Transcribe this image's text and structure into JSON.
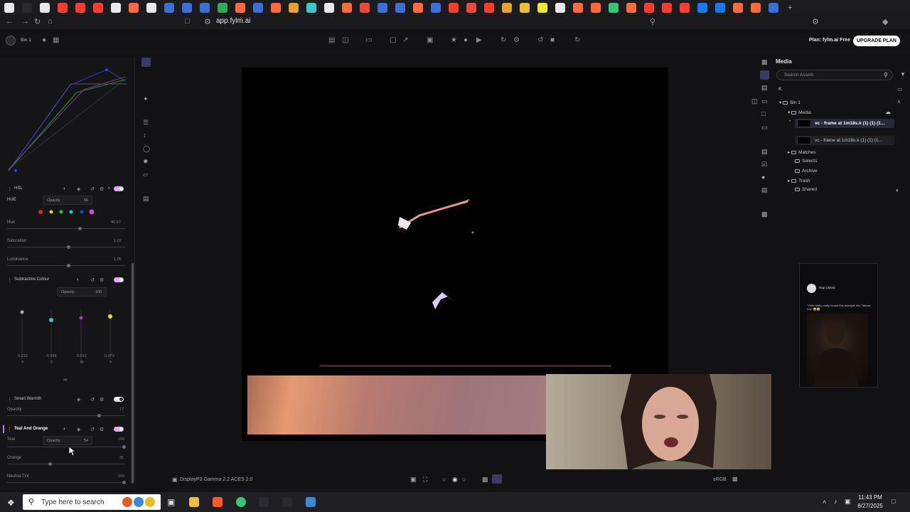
{
  "browser": {
    "url": "app.fylm.ai",
    "tab_favicon_colors": [
      "#e8e8e8",
      "#2b2b2b",
      "#e8e8e8",
      "#ff3b30",
      "#ff3b30",
      "#ff3b30",
      "#e8e8e8",
      "#ff6a3d",
      "#e8e8e8",
      "#3b6fd6",
      "#3b6fd6",
      "#3b6fd6",
      "#34a853",
      "#ff6a3d",
      "#3b6fd6",
      "#ff6a3d",
      "#e8a030",
      "#3ac7c7",
      "#e8e8e8",
      "#ff6a3d",
      "#e84a3d",
      "#3b6fd6",
      "#3b6fd6",
      "#ff6a3d",
      "#3b6fd6",
      "#ff3b30",
      "#e84a3d",
      "#ff3b30",
      "#e8a030",
      "#e8c030",
      "#e8e830",
      "#e8e8e8",
      "#ff6a3d",
      "#ff6a3d",
      "#34c873",
      "#ff6a3d",
      "#ff3b30",
      "#ff3b30",
      "#ff3b30",
      "#1877f2",
      "#1877f2",
      "#ff6a3d",
      "#ff6a3d",
      "#3b6fd6"
    ]
  },
  "app": {
    "workspace": "Bin 1",
    "plan": "Plan: fylm.ai Free",
    "upgrade_label": "UPGRADE PLAN"
  },
  "left_panel": {
    "hsl": {
      "title": "HSL",
      "mode": "HUE",
      "opacity_label": "Opacity",
      "opacity_value": "56",
      "swatches": [
        "#e8202a",
        "#e8d020",
        "#20d040",
        "#20c8c0",
        "#2040e8",
        "#e040e0"
      ],
      "sliders": [
        {
          "label": "Hue",
          "value": "40.67"
        },
        {
          "label": "Saturation",
          "value": "1.02"
        },
        {
          "label": "Luminance",
          "value": "1.05"
        }
      ]
    },
    "subtractive": {
      "title": "Subtractive Colour",
      "opacity_label": "Opacity",
      "opacity_value": "100",
      "values": [
        "0.216",
        "-0.048",
        "0.012",
        "0.072"
      ],
      "letters": [
        "Y",
        "C",
        "M",
        "Y"
      ]
    },
    "smart_warmth": {
      "title": "Smart Warmth",
      "sliders": [
        {
          "label": "Opacity",
          "value": "77"
        }
      ]
    },
    "teal_orange": {
      "title": "Teal And Orange",
      "opacity_label": "Opacity",
      "opacity_value": "54",
      "sliders": [
        {
          "label": "Teal",
          "value": "100"
        },
        {
          "label": "Orange",
          "value": "35"
        },
        {
          "label": "Neutral Tint",
          "value": "100"
        }
      ]
    }
  },
  "viewer": {
    "color_space": "DisplayP3 Gamma 2.2 ACES 2.0",
    "output": "sRGB"
  },
  "media": {
    "title": "Media",
    "search_placeholder": "Search Assets",
    "key_label": "K",
    "bin": "Bin 1",
    "folder_media": "Media",
    "clips": [
      "vc - frame at 1m18s.k (1) (1) (1...",
      "vc - frame at 1m18s.k (1) (1) (1..."
    ],
    "folders": [
      "Matches",
      "Selects",
      "Archive",
      "Trash",
      "Shared"
    ]
  },
  "phone_preview": {
    "account": "Rap United",
    "caption": "\"YNW Melly really turned this freestyle into \"Mama Cry\" 😂😭"
  },
  "taskbar": {
    "search_placeholder": "Type here to search",
    "time": "11:43 PM",
    "date": "8/27/2025"
  }
}
